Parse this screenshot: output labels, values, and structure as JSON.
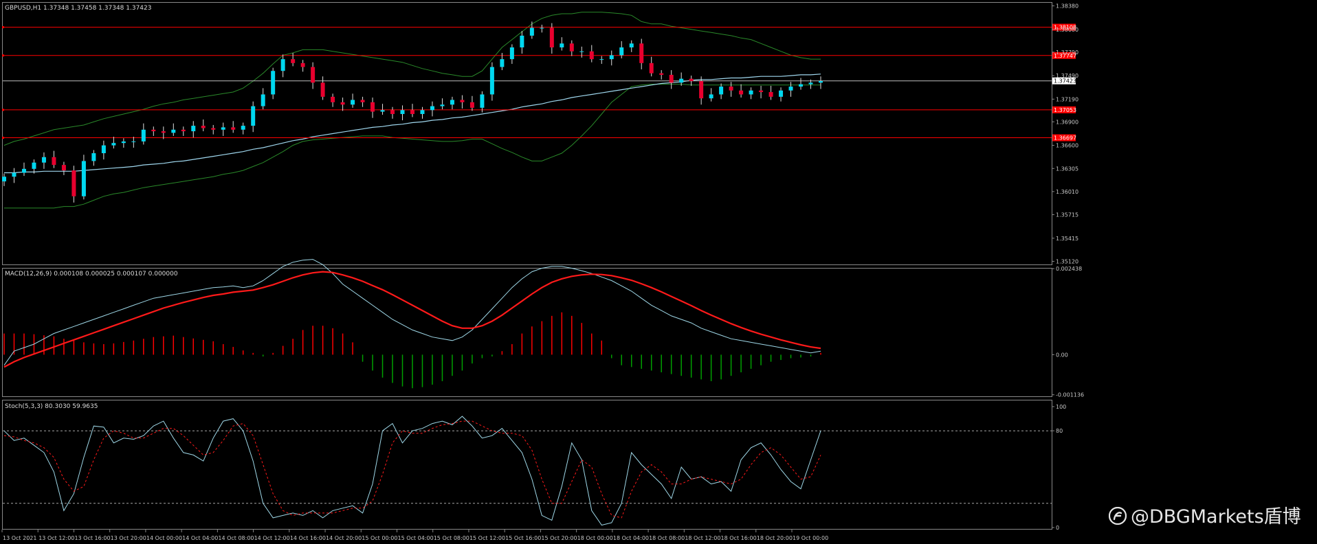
{
  "header": {
    "symbol_line": "GBPUSD,H1  1.37348 1.37458 1.37348 1.37423",
    "macd_label": "MACD(12,26,9) 0.000108 0.000025 0.000107 0.000000",
    "stoch_label": "Stoch(5,3,3) 80.3030 59.9635"
  },
  "watermark": {
    "text": "@DBGMarkets盾博",
    "icon": "weibo-logo-icon"
  },
  "colors": {
    "background": "#000000",
    "bull_candle": "#00d8f0",
    "bear_candle": "#e8002e",
    "macd_signal": "#ff1a1a",
    "macd_main": "#9fd8e8",
    "hist_pos": "#ff0000",
    "hist_neg": "#00a000",
    "bands": "#2a8a2a",
    "ma": "#a0d8ef",
    "hline": "#ff0000",
    "bid_line": "#bfbfbf",
    "grid_text": "#c8c8c8"
  },
  "chart_data": [
    {
      "type": "candlestick",
      "title": "GBPUSD,H1",
      "y_ticks": [
        "1.38380",
        "1.38080",
        "1.37790",
        "1.37490",
        "1.37423",
        "1.37190",
        "1.36900",
        "1.36600",
        "1.36305",
        "1.36010",
        "1.35715",
        "1.35415",
        "1.35120"
      ],
      "ylim": [
        1.3508,
        1.3842
      ],
      "current_price": "1.37423",
      "price_levels": [
        {
          "label": "1.38108",
          "value": 1.38108
        },
        {
          "label": "1.37747",
          "value": 1.37747
        },
        {
          "label": "1.37053",
          "value": 1.37053
        },
        {
          "label": "1.36697",
          "value": 1.36697
        }
      ],
      "x_ticks": [
        "13 Oct 2021",
        "13 Oct 12:00",
        "13 Oct 16:00",
        "13 Oct 20:00",
        "14 Oct 00:00",
        "14 Oct 04:00",
        "14 Oct 08:00",
        "14 Oct 12:00",
        "14 Oct 16:00",
        "14 Oct 20:00",
        "15 Oct 00:00",
        "15 Oct 04:00",
        "15 Oct 08:00",
        "15 Oct 12:00",
        "15 Oct 16:00",
        "15 Oct 20:00",
        "18 Oct 00:00",
        "18 Oct 04:00",
        "18 Oct 08:00",
        "18 Oct 12:00",
        "18 Oct 16:00",
        "18 Oct 20:00",
        "19 Oct 00:00"
      ],
      "close": [
        1.362,
        1.3625,
        1.363,
        1.3638,
        1.3645,
        1.3635,
        1.3628,
        1.3595,
        1.364,
        1.365,
        1.366,
        1.3663,
        1.3665,
        1.3665,
        1.368,
        1.3678,
        1.3676,
        1.368,
        1.3678,
        1.3685,
        1.3682,
        1.368,
        1.3683,
        1.368,
        1.3685,
        1.371,
        1.3725,
        1.3755,
        1.377,
        1.3765,
        1.376,
        1.374,
        1.3722,
        1.3715,
        1.3712,
        1.3718,
        1.3715,
        1.3703,
        1.3705,
        1.37,
        1.3705,
        1.37,
        1.3705,
        1.371,
        1.3712,
        1.3718,
        1.3715,
        1.3708,
        1.3725,
        1.376,
        1.377,
        1.3785,
        1.38,
        1.381,
        1.381,
        1.3785,
        1.379,
        1.378,
        1.378,
        1.377,
        1.377,
        1.3775,
        1.3785,
        1.379,
        1.3765,
        1.3752,
        1.375,
        1.374,
        1.3745,
        1.3742,
        1.372,
        1.3725,
        1.3735,
        1.373,
        1.3725,
        1.373,
        1.3728,
        1.3722,
        1.373,
        1.3735,
        1.3738,
        1.374,
        1.3742
      ],
      "ma": [
        1.3625,
        1.3625,
        1.3626,
        1.3626,
        1.3627,
        1.3627,
        1.3627,
        1.3627,
        1.3628,
        1.3629,
        1.363,
        1.3631,
        1.3632,
        1.3633,
        1.3635,
        1.3636,
        1.3637,
        1.3639,
        1.364,
        1.3642,
        1.3644,
        1.3646,
        1.3648,
        1.365,
        1.3652,
        1.3655,
        1.3657,
        1.366,
        1.3663,
        1.3666,
        1.3668,
        1.3671,
        1.3673,
        1.3675,
        1.3677,
        1.3679,
        1.3681,
        1.3683,
        1.3684,
        1.3686,
        1.3687,
        1.3689,
        1.369,
        1.3692,
        1.3693,
        1.3695,
        1.3696,
        1.3698,
        1.37,
        1.3702,
        1.3704,
        1.3706,
        1.3709,
        1.3711,
        1.3713,
        1.3716,
        1.3718,
        1.3721,
        1.3723,
        1.3725,
        1.3727,
        1.3729,
        1.3731,
        1.3733,
        1.3735,
        1.3737,
        1.3739,
        1.374,
        1.3741,
        1.3743,
        1.3744,
        1.3744,
        1.3745,
        1.3746,
        1.3746,
        1.3747,
        1.3748,
        1.3748,
        1.3748,
        1.3749,
        1.375,
        1.375,
        1.3751
      ],
      "band_upper": [
        1.366,
        1.3665,
        1.3668,
        1.3672,
        1.3676,
        1.368,
        1.3682,
        1.3684,
        1.3686,
        1.369,
        1.3694,
        1.3697,
        1.37,
        1.3703,
        1.3706,
        1.371,
        1.3713,
        1.3715,
        1.3718,
        1.372,
        1.3722,
        1.3724,
        1.3726,
        1.3728,
        1.3733,
        1.3742,
        1.3752,
        1.3764,
        1.3775,
        1.3778,
        1.3782,
        1.3782,
        1.3782,
        1.378,
        1.3778,
        1.3776,
        1.3774,
        1.3772,
        1.377,
        1.3768,
        1.3766,
        1.3762,
        1.3758,
        1.3755,
        1.3752,
        1.375,
        1.3748,
        1.3748,
        1.3755,
        1.377,
        1.3785,
        1.3795,
        1.3805,
        1.3815,
        1.3822,
        1.3826,
        1.3828,
        1.3828,
        1.383,
        1.383,
        1.383,
        1.3829,
        1.3828,
        1.3826,
        1.3818,
        1.3815,
        1.3815,
        1.3812,
        1.381,
        1.3808,
        1.3806,
        1.3804,
        1.3802,
        1.38,
        1.3797,
        1.3795,
        1.379,
        1.3785,
        1.378,
        1.3775,
        1.3772,
        1.377,
        1.377
      ],
      "band_lower": [
        1.358,
        1.358,
        1.358,
        1.358,
        1.358,
        1.358,
        1.3582,
        1.3582,
        1.3585,
        1.359,
        1.3595,
        1.3598,
        1.36,
        1.3603,
        1.3606,
        1.3608,
        1.361,
        1.3612,
        1.3614,
        1.3616,
        1.3618,
        1.362,
        1.3623,
        1.3625,
        1.3628,
        1.3633,
        1.3638,
        1.3645,
        1.3652,
        1.366,
        1.3665,
        1.3667,
        1.3668,
        1.3669,
        1.367,
        1.3671,
        1.3672,
        1.3672,
        1.3672,
        1.367,
        1.3669,
        1.3668,
        1.3667,
        1.3666,
        1.3665,
        1.3665,
        1.3666,
        1.3668,
        1.3668,
        1.3662,
        1.3656,
        1.3651,
        1.3645,
        1.364,
        1.364,
        1.3645,
        1.365,
        1.366,
        1.3672,
        1.3685,
        1.37,
        1.3715,
        1.3725,
        1.3735,
        1.3737,
        1.3738,
        1.3738,
        1.3738,
        1.3738,
        1.3737,
        1.3737,
        1.3737,
        1.3737,
        1.3737,
        1.3737,
        1.3737,
        1.3737,
        1.3737,
        1.3737,
        1.3737,
        1.3737,
        1.3737,
        1.3737
      ]
    },
    {
      "type": "line",
      "title": "MACD(12,26,9)",
      "y_ticks": [
        "0.002438",
        "0.00",
        "-0.001136"
      ],
      "ylim": [
        -0.00118,
        0.00244
      ],
      "main": [
        -0.0003,
        0.0001,
        0.0002,
        0.0003,
        0.00045,
        0.0006,
        0.0007,
        0.0008,
        0.0009,
        0.001,
        0.0011,
        0.0012,
        0.0013,
        0.0014,
        0.0015,
        0.0016,
        0.00165,
        0.0017,
        0.00175,
        0.0018,
        0.00185,
        0.0019,
        0.00192,
        0.00195,
        0.0019,
        0.00195,
        0.0021,
        0.0023,
        0.0025,
        0.00262,
        0.00268,
        0.0027,
        0.00255,
        0.0023,
        0.002,
        0.0018,
        0.0016,
        0.0014,
        0.0012,
        0.001,
        0.00085,
        0.0007,
        0.0006,
        0.0005,
        0.00045,
        0.0004,
        0.0005,
        0.0007,
        0.001,
        0.0013,
        0.0016,
        0.0019,
        0.00215,
        0.00235,
        0.00245,
        0.0025,
        0.0025,
        0.00245,
        0.00238,
        0.0023,
        0.0022,
        0.0021,
        0.00195,
        0.0018,
        0.0016,
        0.0014,
        0.00125,
        0.0011,
        0.001,
        0.0009,
        0.00075,
        0.00065,
        0.00055,
        0.00045,
        0.0004,
        0.00035,
        0.0003,
        0.00025,
        0.0002,
        0.00015,
        0.0001,
        5e-05,
        0.0001
      ],
      "signal": [
        -0.00035,
        -0.0002,
        -8e-05,
        2e-05,
        0.00012,
        0.00022,
        0.00032,
        0.00042,
        0.00052,
        0.00062,
        0.00072,
        0.00082,
        0.00092,
        0.00102,
        0.00112,
        0.00122,
        0.00132,
        0.0014,
        0.00148,
        0.00155,
        0.00162,
        0.00168,
        0.00172,
        0.00177,
        0.0018,
        0.00183,
        0.0019,
        0.00198,
        0.00208,
        0.00218,
        0.00226,
        0.00232,
        0.00235,
        0.00233,
        0.00226,
        0.00218,
        0.00208,
        0.00196,
        0.00184,
        0.0017,
        0.00155,
        0.0014,
        0.00125,
        0.0011,
        0.00095,
        0.00082,
        0.00075,
        0.00075,
        0.00082,
        0.00095,
        0.00112,
        0.00132,
        0.00152,
        0.00172,
        0.0019,
        0.00205,
        0.00215,
        0.00222,
        0.00226,
        0.00228,
        0.00227,
        0.00224,
        0.00218,
        0.00211,
        0.00201,
        0.0019,
        0.00178,
        0.00165,
        0.00152,
        0.00139,
        0.00125,
        0.00112,
        0.001,
        0.00088,
        0.00077,
        0.00067,
        0.00058,
        0.0005,
        0.00042,
        0.00035,
        0.00028,
        0.00022,
        0.00018
      ],
      "histogram": [
        0.0006,
        0.0006,
        0.0006,
        0.00058,
        0.00055,
        0.00052,
        0.00045,
        0.0004,
        0.00035,
        0.00032,
        0.0003,
        0.00032,
        0.00036,
        0.0004,
        0.00045,
        0.0005,
        0.00052,
        0.00054,
        0.0005,
        0.00046,
        0.00042,
        0.00038,
        0.0003,
        0.00022,
        0.00012,
        5e-05,
        -5e-05,
        5e-05,
        0.00025,
        0.00045,
        0.0007,
        0.00082,
        0.00082,
        0.00075,
        0.0006,
        0.00035,
        -0.0002,
        -0.00045,
        -0.00065,
        -0.0008,
        -0.0009,
        -0.00095,
        -0.00092,
        -0.00085,
        -0.00075,
        -0.0006,
        -0.00045,
        -0.00025,
        -0.0001,
        -5e-05,
        0.0001,
        0.0003,
        0.0006,
        0.0008,
        0.00095,
        0.0011,
        0.0012,
        0.0011,
        0.0009,
        0.0006,
        0.0004,
        -0.0001,
        -0.0003,
        -0.00035,
        -0.0004,
        -0.00045,
        -0.0005,
        -0.00055,
        -0.0006,
        -0.00065,
        -0.0007,
        -0.00075,
        -0.0007,
        -0.0006,
        -0.0005,
        -0.0004,
        -0.0003,
        -0.0002,
        -0.00015,
        -0.0001,
        -8e-05,
        -5e-05,
        5e-05
      ]
    },
    {
      "type": "line",
      "title": "Stoch(5,3,3)",
      "y_ticks": [
        "100",
        "80",
        "0"
      ],
      "ylim": [
        0,
        100
      ],
      "levels": [
        80,
        20
      ],
      "main": [
        80,
        72,
        74,
        68,
        62,
        46,
        14,
        28,
        58,
        84,
        83,
        70,
        74,
        73,
        76,
        84,
        88,
        74,
        62,
        60,
        55,
        74,
        88,
        90,
        80,
        55,
        20,
        8,
        10,
        12,
        10,
        14,
        8,
        14,
        16,
        18,
        12,
        36,
        80,
        86,
        70,
        80,
        82,
        86,
        88,
        85,
        92,
        84,
        74,
        76,
        82,
        72,
        62,
        40,
        10,
        6,
        34,
        70,
        56,
        14,
        2,
        4,
        20,
        62,
        52,
        44,
        36,
        24,
        50,
        40,
        42,
        36,
        38,
        30,
        56,
        66,
        70,
        60,
        48,
        38,
        32,
        56,
        80
      ],
      "signal": [
        76,
        75,
        72,
        70,
        66,
        58,
        40,
        30,
        34,
        56,
        74,
        80,
        78,
        74,
        74,
        78,
        82,
        82,
        76,
        68,
        60,
        62,
        72,
        84,
        86,
        76,
        52,
        28,
        14,
        10,
        12,
        12,
        12,
        12,
        14,
        16,
        16,
        22,
        44,
        70,
        80,
        78,
        78,
        82,
        85,
        86,
        88,
        88,
        84,
        80,
        78,
        78,
        76,
        64,
        40,
        20,
        20,
        38,
        56,
        50,
        28,
        10,
        8,
        30,
        46,
        52,
        46,
        36,
        36,
        40,
        42,
        40,
        38,
        36,
        40,
        52,
        62,
        66,
        60,
        50,
        40,
        42,
        60
      ]
    }
  ]
}
